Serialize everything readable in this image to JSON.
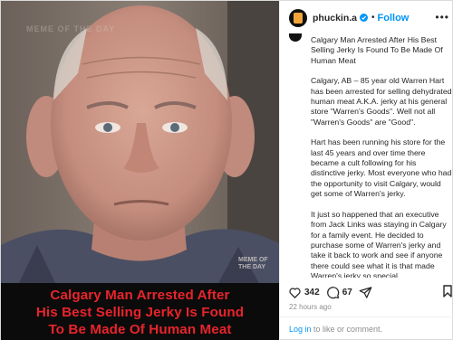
{
  "post": {
    "image_caption": "Calgary Man Arrested After\nHis Best Selling Jerky Is Found\nTo Be Made Of Human Meat",
    "watermark_top": "MEME OF THE DAY",
    "watermark_corner": "MEME OF THE DAY"
  },
  "header": {
    "username": "phuckin.a",
    "separator": "•",
    "follow_label": "Follow",
    "more_label": "•••"
  },
  "caption": {
    "paragraphs": [
      "Calgary Man Arrested After His Best Selling Jerky Is Found To Be Made Of Human Meat",
      "Calgary, AB – 85 year old Warren Hart has been arrested for selling dehydrated human meat A.K.A. jerky at his general store \"Warren's Goods\". Well not all \"Warren's Goods\" are \"Good\".",
      "Hart has been running his store for the last 45 years and over time there became a cult following for his distinctive jerky. Most everyone who had the opportunity to visit Calgary, would get some of Warren's jerky.",
      "It just so happened that an executive from Jack Links was staying in Calgary for a family event. He decided to purchase some of Warren's jerky and take it back to work and see if anyone there could see what it is that made Warren's jerky so special."
    ]
  },
  "actions": {
    "likes": "342",
    "comments": "67"
  },
  "timestamp": "22 hours ago",
  "footer": {
    "login_link": "Log in",
    "login_rest": " to like or comment."
  },
  "colors": {
    "accent": "#0095f6",
    "caption_red": "#e8242b",
    "avatar_orange": "#f2a53b"
  },
  "icons": [
    "verified-badge-icon",
    "more-options-icon",
    "heart-icon",
    "comment-icon",
    "share-icon",
    "bookmark-icon"
  ]
}
